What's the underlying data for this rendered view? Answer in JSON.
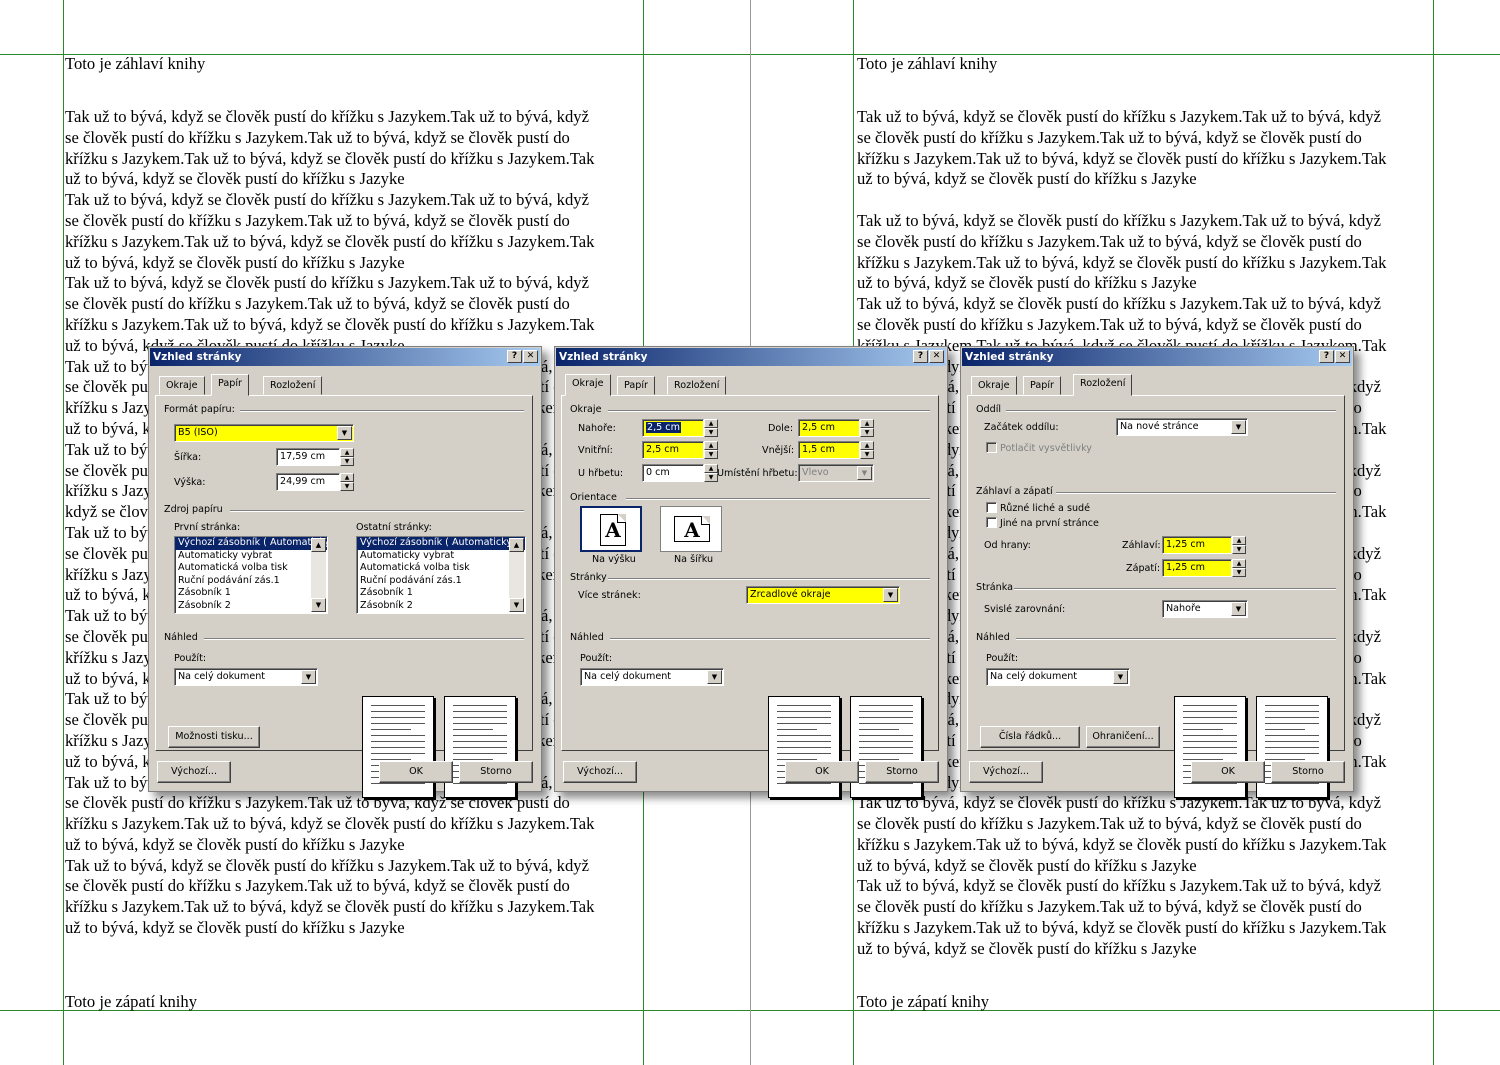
{
  "document": {
    "header_text": "Toto je záhlaví knihy",
    "footer_text": "Toto je zápatí knihy",
    "left_page": {
      "paragraphs": [
        [
          "Tak už to bývá, když se člověk pustí do křížku s Jazykem.Tak už to bývá, když",
          "se člověk pustí do křížku s Jazykem.Tak už to bývá, když se člověk pustí do",
          "křížku s Jazykem.Tak už to bývá, když se člověk pustí do křížku s Jazykem.Tak",
          "už to bývá, když se člověk pustí do křížku s Jazyke"
        ],
        [
          "Tak už to bývá, když se člověk pustí do křížku s Jazykem.Tak už to bývá, když",
          "se člověk pustí do křížku s Jazykem.Tak už to bývá, když se člověk pustí do",
          "křížku s Jazykem.Tak už to bývá, když se člověk pustí do křížku s Jazykem.Tak",
          "už to bývá, když se člověk pustí do křížku s Jazyke"
        ],
        [
          "Tak už to bývá, když se člověk pustí do křížku s Jazykem.Tak už to bývá, když",
          "se člověk pustí do křížku s Jazykem.Tak už to bývá, když se člověk pustí do",
          "křížku s Jazykem.Tak už to bývá, když se člověk pustí do křížku s Jazykem.Tak",
          "už to bývá, když se člověk pustí do křížku s Jazyke"
        ],
        [
          "Tak už to bývá, když se člověk pustí do křížku s Jazykem.Tak už to bývá, když",
          "se člověk pustí do křížku s Jazykem.Tak už to bývá, když se člověk pustí do",
          "křížku s Jazykem.Tak už to bývá, když se člověk pustí do křížku s Jazykem.Tak",
          "už to bývá, když se člověk pustí do křížku s Jazyke"
        ],
        [
          "Tak už to bývá, když se člověk pustí do křížku s Jazykem.Tak už to bývá, když",
          "se člověk pustí do křížku s Jazykem.Tak už to bývá, když se člověk pustí do",
          "křížku s Jazykem.Tak už to bývá, když se člověk pustí do křížku s Jazykem.Tak",
          "když se člověk pustí do křížku s Jazyke"
        ],
        [
          "Tak už to bývá, když se člověk pustí do křížku s Jazykem.Tak už to bývá, když",
          "se člověk pustí do křížku s Jazykem.Tak už to bývá, když se člověk pustí do",
          "křížku s Jazykem.Tak už to bývá, když se člověk pustí do křížku s Jazykem.Tak",
          "už to bývá, když se člověk pustí do křížku s Jazyke"
        ],
        [
          "Tak už to bývá, když se člověk pustí do křížku s Jazykem.Tak už to bývá, když",
          "se člověk pustí do křížku s Jazykem.Tak už to bývá, když se člověk pustí do",
          "křížku s Jazykem.Tak už to bývá, když se člověk pustí do křížku s Jazykem.Tak",
          "už to bývá, když se člověk pustí do křížku s Jazyke"
        ],
        [
          "Tak už to bývá, když se člověk pustí do křížku s Jazykem.Tak už to bývá, když",
          "se člověk pustí do křížku s Jazykem.Tak už to bývá, když se člověk pustí do",
          "křížku s Jazykem.Tak už to bývá, když se člověk pustí do křížku s Jazykem.Tak",
          "už to bývá, když se člověk pustí do křížku s Jazyke"
        ],
        [
          "Tak už to bývá, když se člověk pustí do křížku s Jazykem.Tak už to bývá, když",
          "se člověk pustí do křížku s Jazykem.Tak už to bývá, když se člověk pustí do",
          "křížku s Jazykem.Tak už to bývá, když se člověk pustí do křížku s Jazykem.Tak",
          "už to bývá, když se člověk pustí do křížku s Jazyke"
        ],
        [
          "Tak už to bývá, když se člověk pustí do křížku s Jazykem.Tak už to bývá, když",
          "se člověk pustí do křížku s Jazykem.Tak už to bývá, když se člověk pustí do",
          "křížku s Jazykem.Tak už to bývá, když se člověk pustí do křížku s Jazykem.Tak",
          "už to bývá, když se člověk pustí do křížku s Jazyke"
        ]
      ]
    },
    "right_page": {
      "paragraphs": [
        [
          "Tak už to bývá, když se člověk pustí do křížku s Jazykem.Tak už to bývá, když",
          "se člověk pustí do křížku s Jazykem.Tak už to bývá, když se člověk pustí do",
          "křížku s Jazykem.Tak už to bývá, když se člověk pustí do křížku s Jazykem.Tak",
          "už to bývá, když se člověk pustí do křížku s Jazyke"
        ],
        [
          "Tak už to bývá, když se člověk pustí do křížku s Jazykem.Tak už to bývá, když",
          "se člověk pustí do křížku s Jazykem.Tak už to bývá, když se člověk pustí do",
          "křížku s Jazykem.Tak už to bývá, když se člověk pustí do křížku s Jazykem.Tak",
          "už to bývá, když se člověk pustí do křížku s Jazyke"
        ],
        [
          "Tak už to bývá, když se člověk pustí do křížku s Jazykem.Tak už to bývá, když",
          "se člověk pustí do křížku s Jazykem.Tak už to bývá, když se člověk pustí do",
          "křížku s Jazykem.Tak už to bývá, když se člověk pustí do křížku s Jazykem.Tak",
          "už to bývá, když se člověk pustí do křížku s Jazyke"
        ],
        [
          "Tak už to bývá, když se člověk pustí do křížku s Jazykem.Tak už to bývá, když",
          "se člověk pustí do křížku s Jazykem.Tak už to bývá, když se člověk pustí do",
          "křížku s Jazykem.Tak už to bývá, když se člověk pustí do křížku s Jazykem.Tak",
          "už to bývá, když se člověk pustí do křížku s Jazyke"
        ],
        [
          "Tak už to bývá, když se člověk pustí do křížku s Jazykem.Tak už to bývá, když",
          "se člověk pustí do křížku s Jazykem.Tak už to bývá, když se člověk pustí do",
          "křížku s Jazykem.Tak už to bývá, když se člověk pustí do křížku s Jazykem.Tak",
          "už to bývá, když se člověk pustí do křížku s Jazyke"
        ],
        [
          "Tak už to bývá, když se člověk pustí do křížku s Jazykem.Tak už to bývá, když",
          "se člověk pustí do křížku s Jazykem.Tak už to bývá, když se člověk pustí do",
          "křížku s Jazykem.Tak už to bývá, když se člověk pustí do křížku s Jazykem.Tak",
          "už to bývá, když se člověk pustí do křížku s Jazyke"
        ],
        [
          "Tak už to bývá, když se člověk pustí do křížku s Jazykem.Tak už to bývá, když",
          "se člověk pustí do křížku s Jazykem.Tak už to bývá, když se člověk pustí do",
          "křížku s Jazykem.Tak už to bývá, když se člověk pustí do křížku s Jazykem.Tak",
          "už to bývá, když se člověk pustí do křížku s Jazyke"
        ],
        [
          "Tak už to bývá, když se člověk pustí do křížku s Jazykem.Tak už to bývá, když",
          "se člověk pustí do křížku s Jazykem.Tak už to bývá, když se člověk pustí do",
          "křížku s Jazykem.Tak už to bývá, když se člověk pustí do křížku s Jazykem.Tak",
          "už to bývá, když se člověk pustí do křížku s Jazyke"
        ],
        [
          "Tak už to bývá, když se člověk pustí do křížku s Jazykem.Tak už to bývá, když",
          "se člověk pustí do křížku s Jazykem.Tak už to bývá, když se člověk pustí do",
          "křížku s Jazykem.Tak už to bývá, když se člověk pustí do křížku s Jazykem.Tak",
          "už to bývá, když se člověk pustí do křížku s Jazyke"
        ],
        [
          "Tak už to bývá, když se člověk pustí do křížku s Jazykem.Tak už to bývá, když",
          "se člověk pustí do křížku s Jazykem.Tak už to bývá, když se člověk pustí do",
          "křížku s Jazykem.Tak už to bývá, když se člověk pustí do křížku s Jazykem.Tak",
          "už to bývá, když se člověk pustí do křížku s Jazyke"
        ]
      ]
    }
  },
  "dialog_common": {
    "title": "Vzhled stránky",
    "help_glyph": "?",
    "close_glyph": "✕",
    "tabs": [
      "Okraje",
      "Papír",
      "Rozložení"
    ],
    "preview_label": "Náhled",
    "apply_label": "Použít:",
    "apply_value": "Na celý dokument",
    "default_button": "Výchozí...",
    "ok_button": "OK",
    "cancel_button": "Storno"
  },
  "dialog_paper": {
    "paper_size_label": "Formát papíru:",
    "paper_size_value": "B5 (ISO)",
    "width_label": "Šířka:",
    "width_value": "17,59 cm",
    "height_label": "Výška:",
    "height_value": "24,99 cm",
    "paper_source_label": "Zdroj papíru",
    "first_page_label": "První stránka:",
    "other_pages_label": "Ostatní stránky:",
    "first_page_items": [
      "Výchozí zásobník ( Automatický",
      "Automaticky vybrat",
      "Automatická volba tisk",
      "Ruční podávání zás.1",
      "Zásobník 1",
      "Zásobník 2"
    ],
    "other_pages_items": [
      "Výchozí zásobník ( Automaticky v",
      "Automaticky vybrat",
      "Automatická volba tisk",
      "Ruční podávání zás.1",
      "Zásobník 1",
      "Zásobník 2"
    ],
    "print_options_button": "Možnosti tisku..."
  },
  "dialog_margins": {
    "margins_label": "Okraje",
    "top_label": "Nahoře:",
    "top_value": "2,5 cm",
    "bottom_label": "Dole:",
    "bottom_value": "2,5 cm",
    "inside_label": "Vnitřní:",
    "inside_value": "2,5 cm",
    "outside_label": "Vnější:",
    "outside_value": "1,5 cm",
    "gutter_label": "U hřbetu:",
    "gutter_value": "0 cm",
    "gutter_pos_label": "Umístění hřbetu:",
    "gutter_pos_value": "Vlevo",
    "orientation_label": "Orientace",
    "portrait_label": "Na výšku",
    "landscape_label": "Na šířku",
    "orientation_glyph": "A",
    "pages_label": "Stránky",
    "multiple_pages_label": "Více stránek:",
    "multiple_pages_value": "Zrcadlové okraje"
  },
  "dialog_layout": {
    "section_label": "Oddíl",
    "section_start_label": "Začátek oddílu:",
    "section_start_value": "Na nové stránce",
    "suppress_endnotes_label": "Potlačit vysvětlivky",
    "headers_footers_label": "Záhlaví a zápatí",
    "odd_even_label": "Různé liché a sudé",
    "first_page_diff_label": "Jiné na první stránce",
    "from_edge_label": "Od hrany:",
    "header_label": "Záhlaví:",
    "header_value": "1,25 cm",
    "footer_label": "Zápatí:",
    "footer_value": "1,25 cm",
    "page_label": "Stránka",
    "vertical_align_label": "Svislé zarovnání:",
    "vertical_align_value": "Nahoře",
    "line_numbers_button": "Čísla řádků...",
    "borders_button": "Ohraničení..."
  },
  "colors": {
    "highlight": "#ffff00",
    "title_bar": "#0a246a",
    "dialog_face": "#d4d0c8",
    "guide_line": "#2a8a2a"
  }
}
